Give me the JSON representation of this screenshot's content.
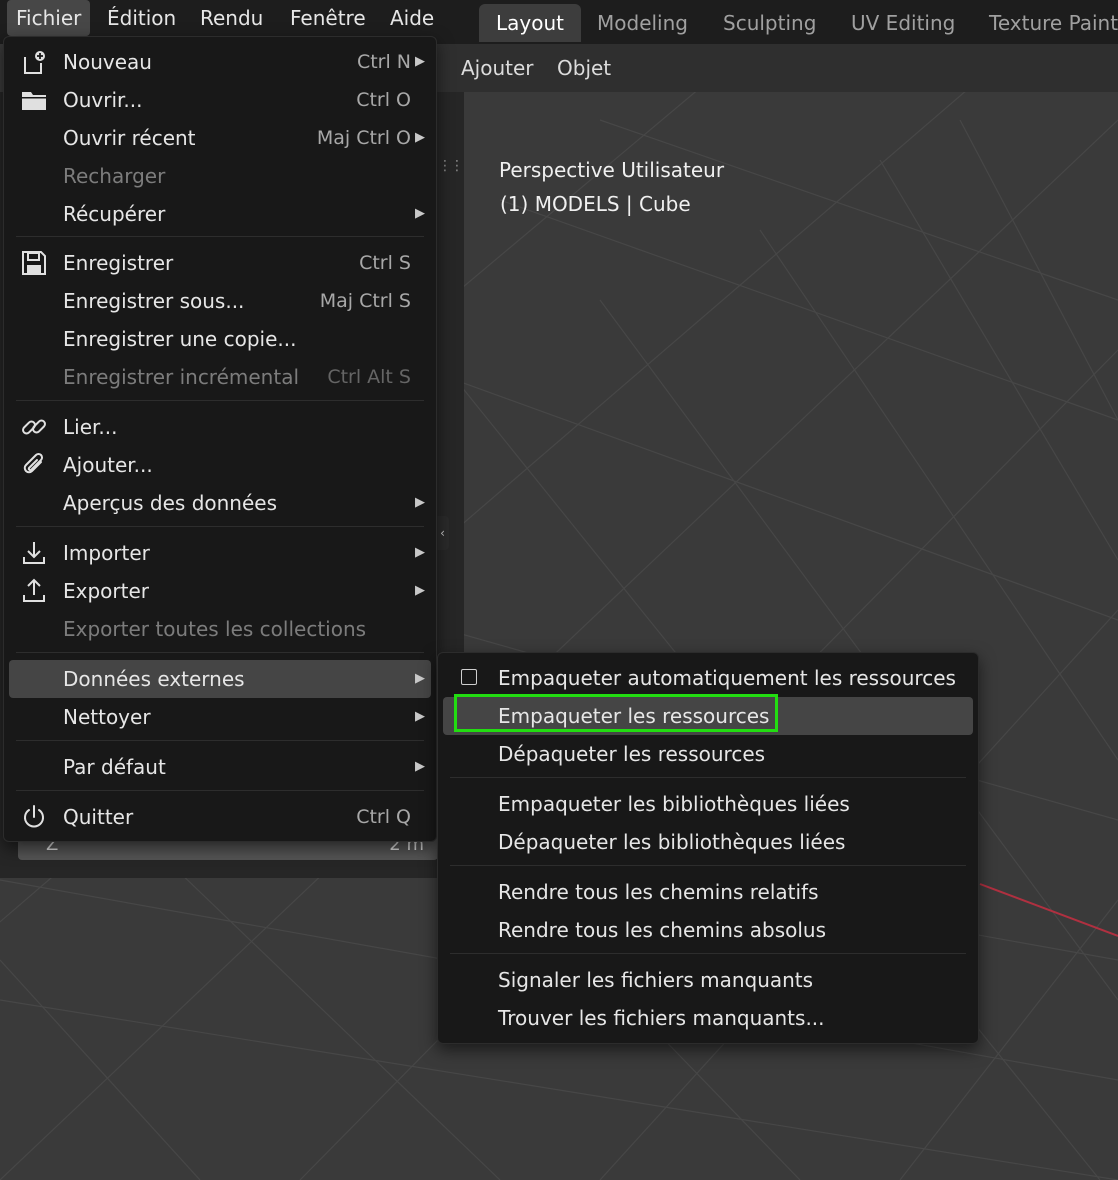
{
  "main_menu": {
    "items": [
      {
        "label": "Fichier",
        "active": true
      },
      {
        "label": "Édition"
      },
      {
        "label": "Rendu"
      },
      {
        "label": "Fenêtre"
      },
      {
        "label": "Aide"
      }
    ]
  },
  "workspace_tabs": [
    {
      "label": "Layout",
      "active": true
    },
    {
      "label": "Modeling"
    },
    {
      "label": "Sculpting"
    },
    {
      "label": "UV Editing"
    },
    {
      "label": "Texture Paint"
    }
  ],
  "viewport": {
    "header_menus": [
      "Ajouter",
      "Objet"
    ],
    "view_name": "Perspective Utilisateur",
    "object_info": "(1) MODELS | Cube"
  },
  "side_panel": {
    "left_value": "Z",
    "right_value": "2 m"
  },
  "file_menu": {
    "items": [
      {
        "label": "Nouveau",
        "shortcut": "Ctrl N",
        "icon": "new-file-icon",
        "submenu": true
      },
      {
        "label": "Ouvrir...",
        "shortcut": "Ctrl O",
        "icon": "folder-icon"
      },
      {
        "label": "Ouvrir récent",
        "shortcut": "Maj Ctrl O",
        "submenu": true
      },
      {
        "label": "Recharger",
        "disabled": true
      },
      {
        "label": "Récupérer",
        "submenu": true
      },
      {
        "label": "Enregistrer",
        "shortcut": "Ctrl S",
        "icon": "save-icon"
      },
      {
        "label": "Enregistrer sous...",
        "shortcut": "Maj Ctrl S"
      },
      {
        "label": "Enregistrer une copie..."
      },
      {
        "label": "Enregistrer incrémental",
        "shortcut": "Ctrl Alt S",
        "disabled": true
      },
      {
        "label": "Lier...",
        "icon": "link-icon"
      },
      {
        "label": "Ajouter...",
        "icon": "append-icon"
      },
      {
        "label": "Aperçus des données",
        "submenu": true
      },
      {
        "label": "Importer",
        "icon": "import-icon",
        "submenu": true
      },
      {
        "label": "Exporter",
        "icon": "export-icon",
        "submenu": true
      },
      {
        "label": "Exporter toutes les collections",
        "disabled": true
      },
      {
        "label": "Données externes",
        "submenu": true,
        "hover": true
      },
      {
        "label": "Nettoyer",
        "submenu": true
      },
      {
        "label": "Par défaut",
        "submenu": true
      },
      {
        "label": "Quitter",
        "shortcut": "Ctrl Q",
        "icon": "power-icon"
      }
    ]
  },
  "external_data_submenu": {
    "items": [
      {
        "label": "Empaqueter automatiquement les ressources",
        "checkbox": true,
        "checked": false
      },
      {
        "label": "Empaqueter les ressources",
        "hover": true,
        "highlighted": true
      },
      {
        "label": "Dépaqueter les ressources"
      },
      {
        "label": "Empaqueter les bibliothèques liées"
      },
      {
        "label": "Dépaqueter les bibliothèques liées"
      },
      {
        "label": "Rendre tous les chemins relatifs"
      },
      {
        "label": "Rendre tous les chemins absolus"
      },
      {
        "label": "Signaler les fichiers manquants"
      },
      {
        "label": "Trouver les fichiers manquants..."
      }
    ]
  },
  "colors": {
    "highlight": "#22dd11",
    "menu_bg": "#181818",
    "hover_bg": "#454545",
    "x_axis": "#b03040"
  }
}
